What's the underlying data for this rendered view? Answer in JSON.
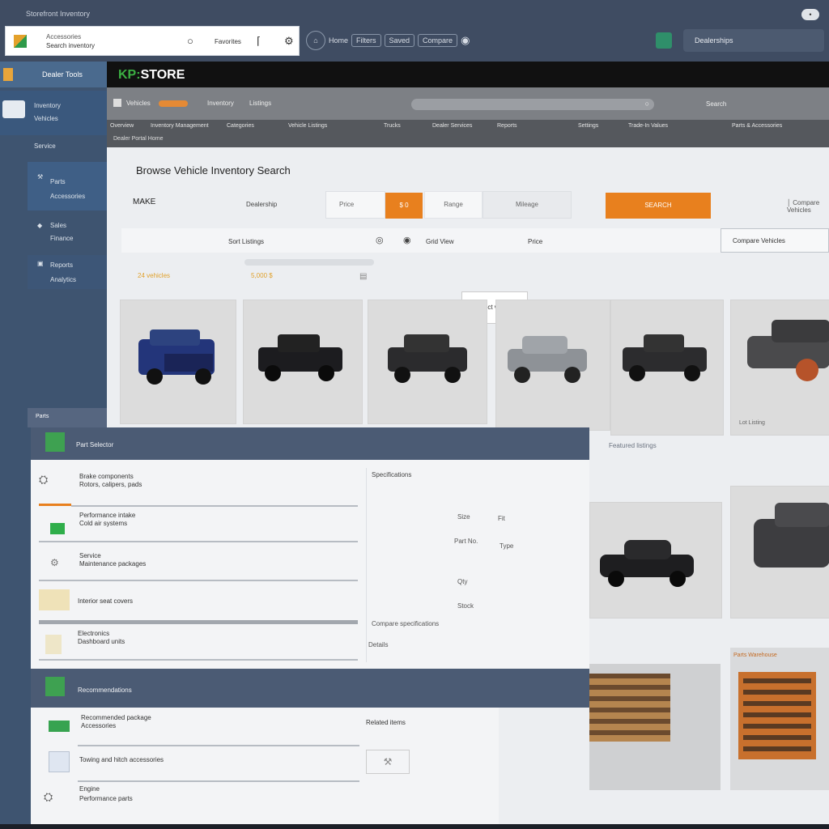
{
  "window": {
    "title": "Storefront Inventory",
    "control": "•"
  },
  "search": {
    "line1": "Accessories",
    "line2": "Search inventory",
    "btn_a": "Q",
    "btn_b": "Favorites"
  },
  "toolbar": {
    "items": [
      "Home",
      "Filters",
      "Saved",
      "Compare"
    ],
    "account": "Dealerships"
  },
  "sidebar": {
    "header": "Dealer Tools",
    "items": [
      {
        "label": "Inventory",
        "sub": "Vehicles"
      },
      {
        "label": "Service"
      },
      {
        "label": "Parts",
        "sub": "Accessories"
      },
      {
        "label": "Sales",
        "sub": "Finance"
      },
      {
        "label": "Reports",
        "sub": "Analytics"
      }
    ]
  },
  "store": {
    "logo_prefix": "KP:",
    "logo_name": "STORE",
    "breadcrumb": [
      "Vehicles",
      "Inventory",
      "Listings"
    ],
    "search_hint": "Search",
    "nav": [
      "Overview",
      "Inventory Management",
      "Categories",
      "Vehicle Listings",
      "Trucks",
      "Dealer Services",
      "Reports",
      "Settings",
      "Trade-In Values",
      "Parts & Accessories"
    ],
    "sub_nav": "Dealer Portal Home"
  },
  "main": {
    "title": "Browse Vehicle Inventory Search",
    "filter_label": "MAKE",
    "filter_value": "Dealership",
    "price_label": "Price",
    "range_a": "$ 0",
    "range_b": "Range",
    "range_c": "Mileage",
    "search_btn": "SEARCH",
    "sort_label": "Sort Listings",
    "view_a": "Grid View",
    "view_b": "Price",
    "compare_btn": "Compare Vehicles",
    "tooltip": "Select vehicle",
    "results_a": "24 vehicles",
    "results_b": "5,000 $",
    "caption": "Featured listings"
  },
  "panel1": {
    "tab": "Parts",
    "title": "Part Selector",
    "rows": [
      {
        "t1": "Brake components",
        "t2": "Rotors, calipers, pads"
      },
      {
        "t1": "Performance intake",
        "t2": "Cold air systems"
      },
      {
        "t1": "Service",
        "t2": "Maintenance packages"
      },
      {
        "t1": "Interior seat covers"
      },
      {
        "t1": "Electronics",
        "t2": "Dashboard units"
      }
    ],
    "detail_title": "Specifications",
    "detail_items": [
      "Size",
      "Fit",
      "Part No.",
      "Type",
      "Qty",
      "Stock"
    ],
    "detail_foot": "Compare specifications",
    "detail_link": "Details"
  },
  "panel2": {
    "title": "Recommendations",
    "rows": [
      {
        "t1": "Recommended package",
        "t2": "Accessories"
      },
      {
        "t1": "Towing and hitch accessories"
      },
      {
        "t1": "Engine",
        "t2": "Performance parts"
      }
    ],
    "side_text": "Related items"
  },
  "right": {
    "lot_label": "Lot Listing",
    "warehouse": "Parts Warehouse"
  }
}
